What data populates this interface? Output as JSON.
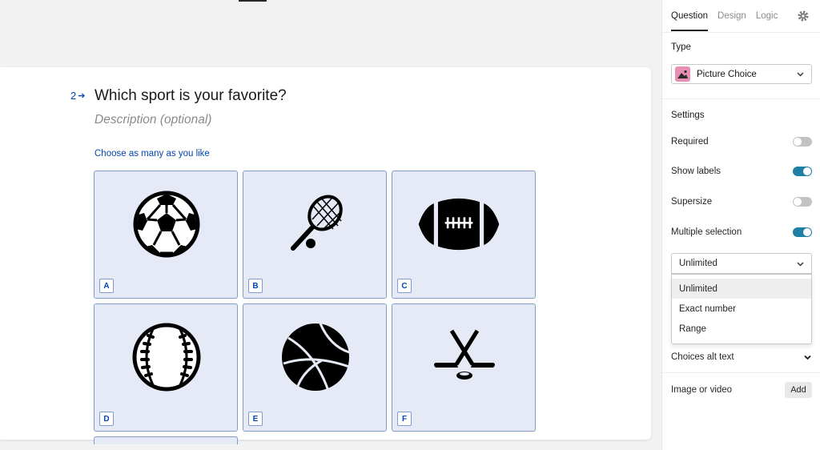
{
  "question": {
    "number": "2",
    "title": "Which sport is your favorite?",
    "description_placeholder": "Description (optional)",
    "hint": "Choose as many as you like",
    "choices": [
      {
        "key": "A",
        "icon": "soccer-ball-icon"
      },
      {
        "key": "B",
        "icon": "tennis-racket-icon"
      },
      {
        "key": "C",
        "icon": "american-football-icon"
      },
      {
        "key": "D",
        "icon": "baseball-icon"
      },
      {
        "key": "E",
        "icon": "basketball-icon"
      },
      {
        "key": "F",
        "icon": "hockey-sticks-icon"
      }
    ]
  },
  "panel": {
    "tabs": [
      "Question",
      "Design",
      "Logic"
    ],
    "active_tab": "Question",
    "type_label": "Type",
    "type_value": "Picture Choice",
    "settings_label": "Settings",
    "settings": {
      "required": {
        "label": "Required",
        "on": false
      },
      "show_labels": {
        "label": "Show labels",
        "on": true
      },
      "supersize": {
        "label": "Supersize",
        "on": false
      },
      "multiple_selection": {
        "label": "Multiple selection",
        "on": true
      }
    },
    "limit_select": {
      "value": "Unlimited",
      "options": [
        "Unlimited",
        "Exact number",
        "Range"
      ]
    },
    "choices_alt_text": "Choices alt text",
    "image_or_video": "Image or video",
    "add_label": "Add"
  },
  "colors": {
    "accent_blue": "#0445af",
    "toggle_on": "#1f7fa5",
    "choice_bg": "#e6eaf6",
    "type_icon_bg": "#e88fb6"
  }
}
